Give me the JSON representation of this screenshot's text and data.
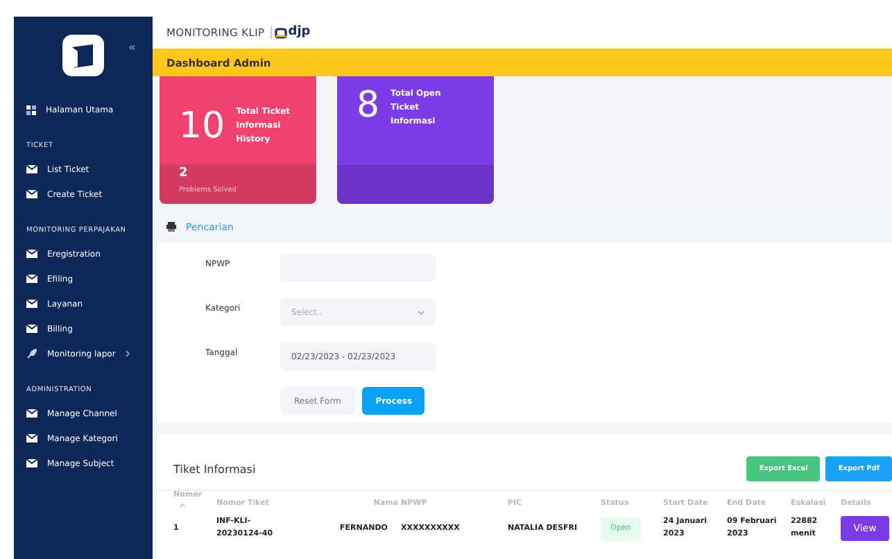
{
  "sidebar": {
    "collapse_glyph": "«",
    "items": [
      {
        "kind": "home",
        "label": "Halaman Utama"
      }
    ],
    "sections": [
      {
        "title": "TICKET",
        "items": [
          {
            "kind": "link",
            "label": "List Ticket"
          },
          {
            "kind": "link",
            "label": "Create Ticket"
          }
        ]
      },
      {
        "title": "MONITORING PERPAJAKAN",
        "items": [
          {
            "kind": "link",
            "label": "Eregistration"
          },
          {
            "kind": "link",
            "label": "Efiling"
          },
          {
            "kind": "link",
            "label": "Layanan"
          },
          {
            "kind": "link",
            "label": "Billing"
          },
          {
            "kind": "submenu",
            "label": "Monitoring lapor"
          }
        ]
      },
      {
        "title": "ADMINISTRATION",
        "items": [
          {
            "kind": "link",
            "label": "Manage Channel"
          },
          {
            "kind": "link",
            "label": "Manage Kategori"
          },
          {
            "kind": "link",
            "label": "Manage Subject"
          }
        ]
      }
    ]
  },
  "header": {
    "brand": "MONITORING KLIP",
    "logo_text": "djp"
  },
  "page_title": "Dashboard Admin",
  "cards": [
    {
      "value": "10",
      "label": "Total Ticket Informasi History",
      "footer_value": "2",
      "footer_label": "Problems Solved",
      "color": "#f0426e"
    },
    {
      "value": "8",
      "label": "Total Open Ticket Informasi",
      "color": "#7b3be6"
    }
  ],
  "search": {
    "title": "Pencarian",
    "fields": [
      {
        "kind": "text",
        "label": "NPWP"
      },
      {
        "kind": "select",
        "label": "Kategori",
        "placeholder": "Select.."
      },
      {
        "kind": "daterange",
        "label": "Tanggal",
        "value": "02/23/2023 - 02/23/2023"
      }
    ],
    "buttons": [
      {
        "kind": "secondary",
        "label": "Reset Form"
      },
      {
        "kind": "primary",
        "label": "Process"
      }
    ]
  },
  "table": {
    "title": "Tiket Informasi",
    "buttons": [
      {
        "label": "Export Excel",
        "color": "#45c77f"
      },
      {
        "label": "Export Pdf",
        "color": "#1aa3f5"
      }
    ],
    "columns": [
      {
        "label": "Nomor",
        "sorted": true
      },
      {
        "label": "Nomor Tiket",
        "sorted": false
      },
      {
        "label": "Nama",
        "sorted": false
      },
      {
        "label": "NPWP",
        "sorted": false
      },
      {
        "label": "PIC",
        "sorted": false
      },
      {
        "label": "Status",
        "sorted": false
      },
      {
        "label": "Start Date",
        "sorted": false
      },
      {
        "label": "End Date",
        "sorted": false
      },
      {
        "label": "Eskalasi",
        "sorted": false
      },
      {
        "label": "Details",
        "sorted": false
      }
    ],
    "rows": [
      {
        "nomor": "1",
        "nomor_tiket": "INF-KLI-20230124-40",
        "nama": "FERNANDO",
        "npwp": "XXXXXXXXXX",
        "pic": "NATALIA DESFRI",
        "status": "Open",
        "start_date": "24 Januari 2023",
        "end_date": "09 Februari 2023",
        "eskalasi": "22882 menit",
        "action": "View"
      }
    ]
  }
}
